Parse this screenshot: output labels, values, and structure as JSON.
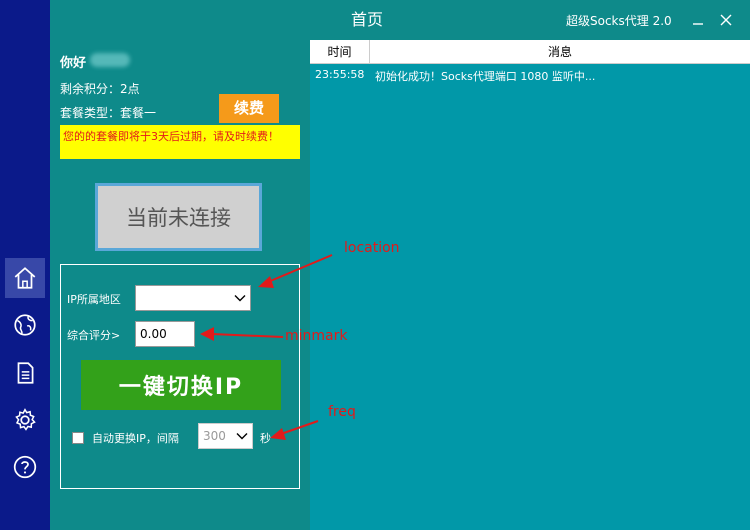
{
  "window": {
    "title": "首页",
    "app_name": "超级Socks代理 2.0"
  },
  "sidebar": {
    "items": [
      {
        "icon": "home-icon",
        "active": true
      },
      {
        "icon": "globe-icon",
        "active": false
      },
      {
        "icon": "document-icon",
        "active": false
      },
      {
        "icon": "gear-icon",
        "active": false
      },
      {
        "icon": "help-icon",
        "active": false
      }
    ]
  },
  "account": {
    "greeting": "你好",
    "points": "剩余积分：2点",
    "plan": "套餐类型：套餐一",
    "renew_label": "续费",
    "warning": "您的的套餐即将于3天后过期，请及时续费！"
  },
  "connection": {
    "status_label": "当前未连接"
  },
  "settings": {
    "region_label": "IP所属地区",
    "region_value": "",
    "score_label": "综合评分>",
    "score_value": "0.00",
    "switch_label": "一键切换IP",
    "auto_label": "自动更换IP，间隔",
    "interval_value": "300",
    "unit_label": "秒"
  },
  "log": {
    "columns": [
      "时间",
      "消息"
    ],
    "rows": [
      {
        "time": "23:55:58",
        "message": "初始化成功！Socks代理端口 1080 监听中..."
      }
    ]
  },
  "annotations": {
    "location": "location",
    "minmark": "minmark",
    "freq": "freq"
  },
  "colors": {
    "accent_teal": "#0e8a8a",
    "log_bg": "#0198a8",
    "sidebar": "#0b1a8a",
    "renew": "#f59a1a",
    "switch": "#33a11a",
    "annotation": "#e21a1a"
  }
}
